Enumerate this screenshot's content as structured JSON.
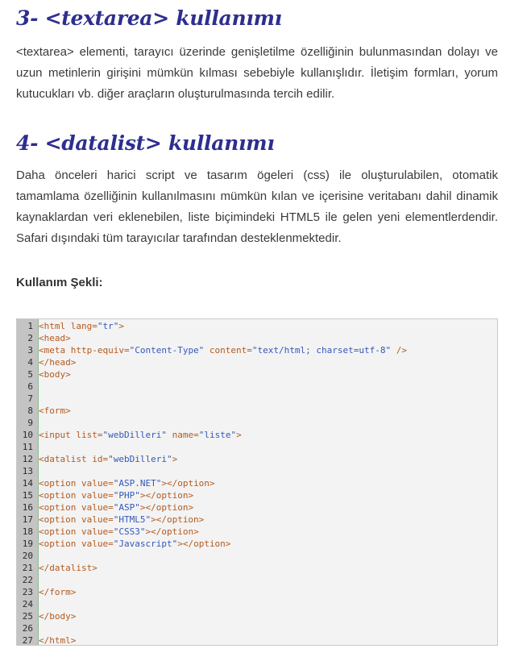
{
  "sections": [
    {
      "heading": "3- <textarea> kullanımı",
      "paragraph": "<textarea> elementi, tarayıcı üzerinde genişletilme özelliğinin bulunmasından dolayı ve uzun metinlerin girişini mümkün kılması sebebiyle kullanışlıdır. İletişim formları, yorum kutucukları vb. diğer araçların oluşturulmasında tercih edilir."
    },
    {
      "heading": "4- <datalist> kullanımı",
      "paragraph": "Daha önceleri harici script ve tasarım ögeleri (css) ile oluşturulabilen, otomatik tamamlama özelliğinin kullanılmasını mümkün kılan ve içerisine veritabanı dahil dinamik kaynaklardan veri eklenebilen, liste biçimindeki HTML5 ile gelen yeni elementlerdendir. Safari dışındaki tüm tarayıcılar tarafından desteklenmektedir."
    }
  ],
  "usage_label": "Kullanım Şekli:",
  "code": {
    "lines": [
      "<html lang=\"tr\">",
      "<head>",
      "<meta http-equiv=\"Content-Type\" content=\"text/html; charset=utf-8\" />",
      "</head>",
      "<body>",
      "",
      "",
      "<form>",
      "",
      "<input list=\"webDilleri\" name=\"liste\">",
      "",
      "<datalist id=\"webDilleri\">",
      "",
      "<option value=\"ASP.NET\"></option>",
      "<option value=\"PHP\"></option>",
      "<option value=\"ASP\"></option>",
      "<option value=\"HTML5\"></option>",
      "<option value=\"CSS3\"></option>",
      "<option value=\"Javascript\"></option>",
      "",
      "</datalist>",
      "",
      "</form>",
      "",
      "</body>",
      "",
      "</html>"
    ]
  },
  "colors": {
    "heading": "#2e2e8f",
    "code_tag": "#b35a1f",
    "code_string": "#3558b8"
  }
}
